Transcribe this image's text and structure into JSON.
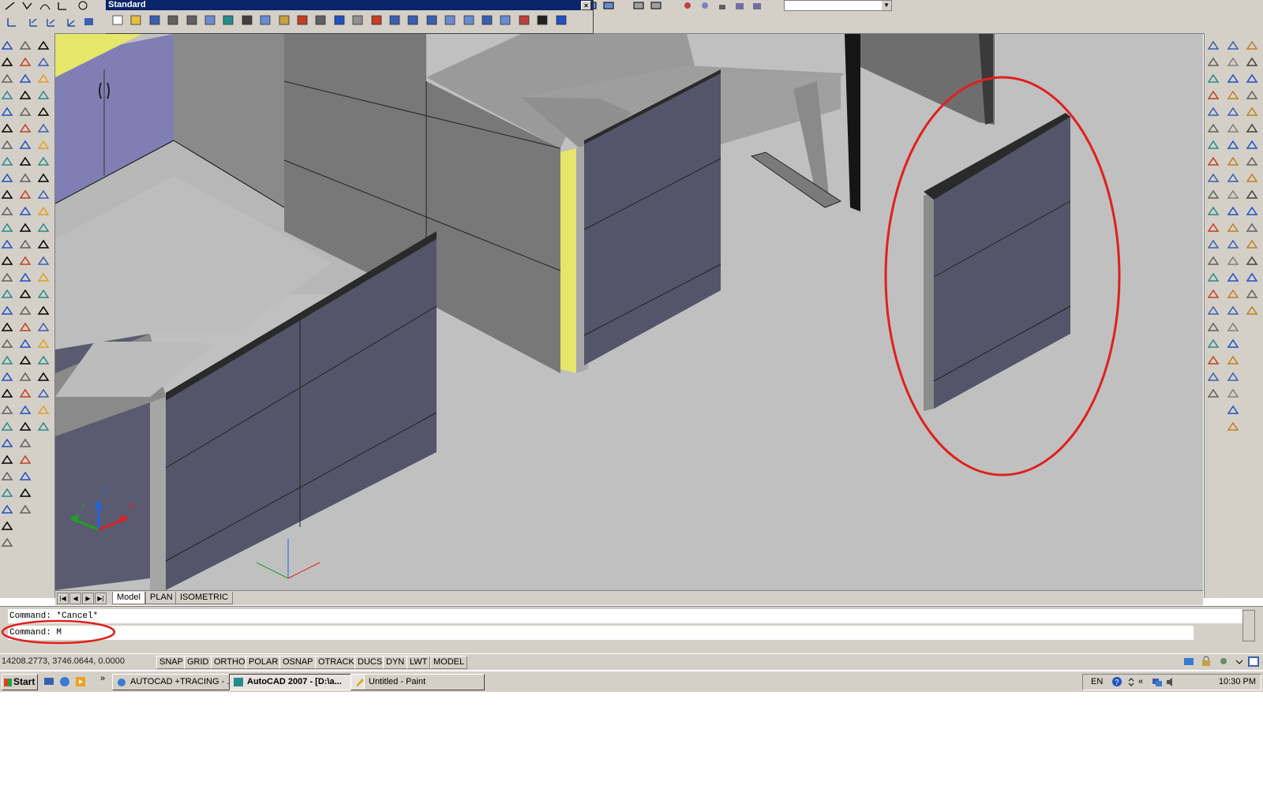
{
  "toolbar": {
    "title": "Standard",
    "close_glyph": "×",
    "icons": [
      "new-icon",
      "open-icon",
      "save-icon",
      "plot-icon",
      "plot-preview-icon",
      "publish-icon",
      "3d-dwf-icon",
      "cut-icon",
      "copy-icon",
      "paste-icon",
      "match-properties-icon",
      "block-editor-icon",
      "undo-icon",
      "redo-icon",
      "pan-icon",
      "zoom-realtime-icon",
      "zoom-window-icon",
      "zoom-previous-icon",
      "properties-icon",
      "design-center-icon",
      "tool-palettes-icon",
      "sheet-set-icon",
      "markup-icon",
      "quickcalc-icon",
      "help-icon"
    ]
  },
  "layout_tabs": {
    "nav": [
      "|◀",
      "◀",
      "▶",
      "▶|"
    ],
    "tabs": [
      {
        "label": "Model",
        "active": true
      },
      {
        "label": "PLAN",
        "active": false
      },
      {
        "label": "ISOMETRIC",
        "active": false
      }
    ]
  },
  "command": {
    "history": "Command: *Cancel*",
    "current": "Command: M"
  },
  "status": {
    "coordinates": "14208.2773, 3746.0644, 0.0000",
    "modes": [
      "SNAP",
      "GRID",
      "ORTHO",
      "POLAR",
      "OSNAP",
      "OTRACK",
      "DUCS",
      "DYN",
      "LWT",
      "MODEL"
    ]
  },
  "taskbar": {
    "start": "Start",
    "tasks": [
      {
        "label": "AUTOCAD +TRACING - ...",
        "active": false
      },
      {
        "label": "AutoCAD 2007 - [D:\\a...",
        "active": true
      },
      {
        "label": "Untitled - Paint",
        "active": false
      }
    ],
    "language": "EN",
    "clock": "10:30 PM"
  },
  "colors": {
    "panel_face": "#54556a",
    "desk_top": "#a3a3a3",
    "floor": "#c0c0c0",
    "highlight_ellipse": "#e0201c",
    "yellow_trim": "#e6e66a",
    "cabinet": "#7f7fb4"
  }
}
